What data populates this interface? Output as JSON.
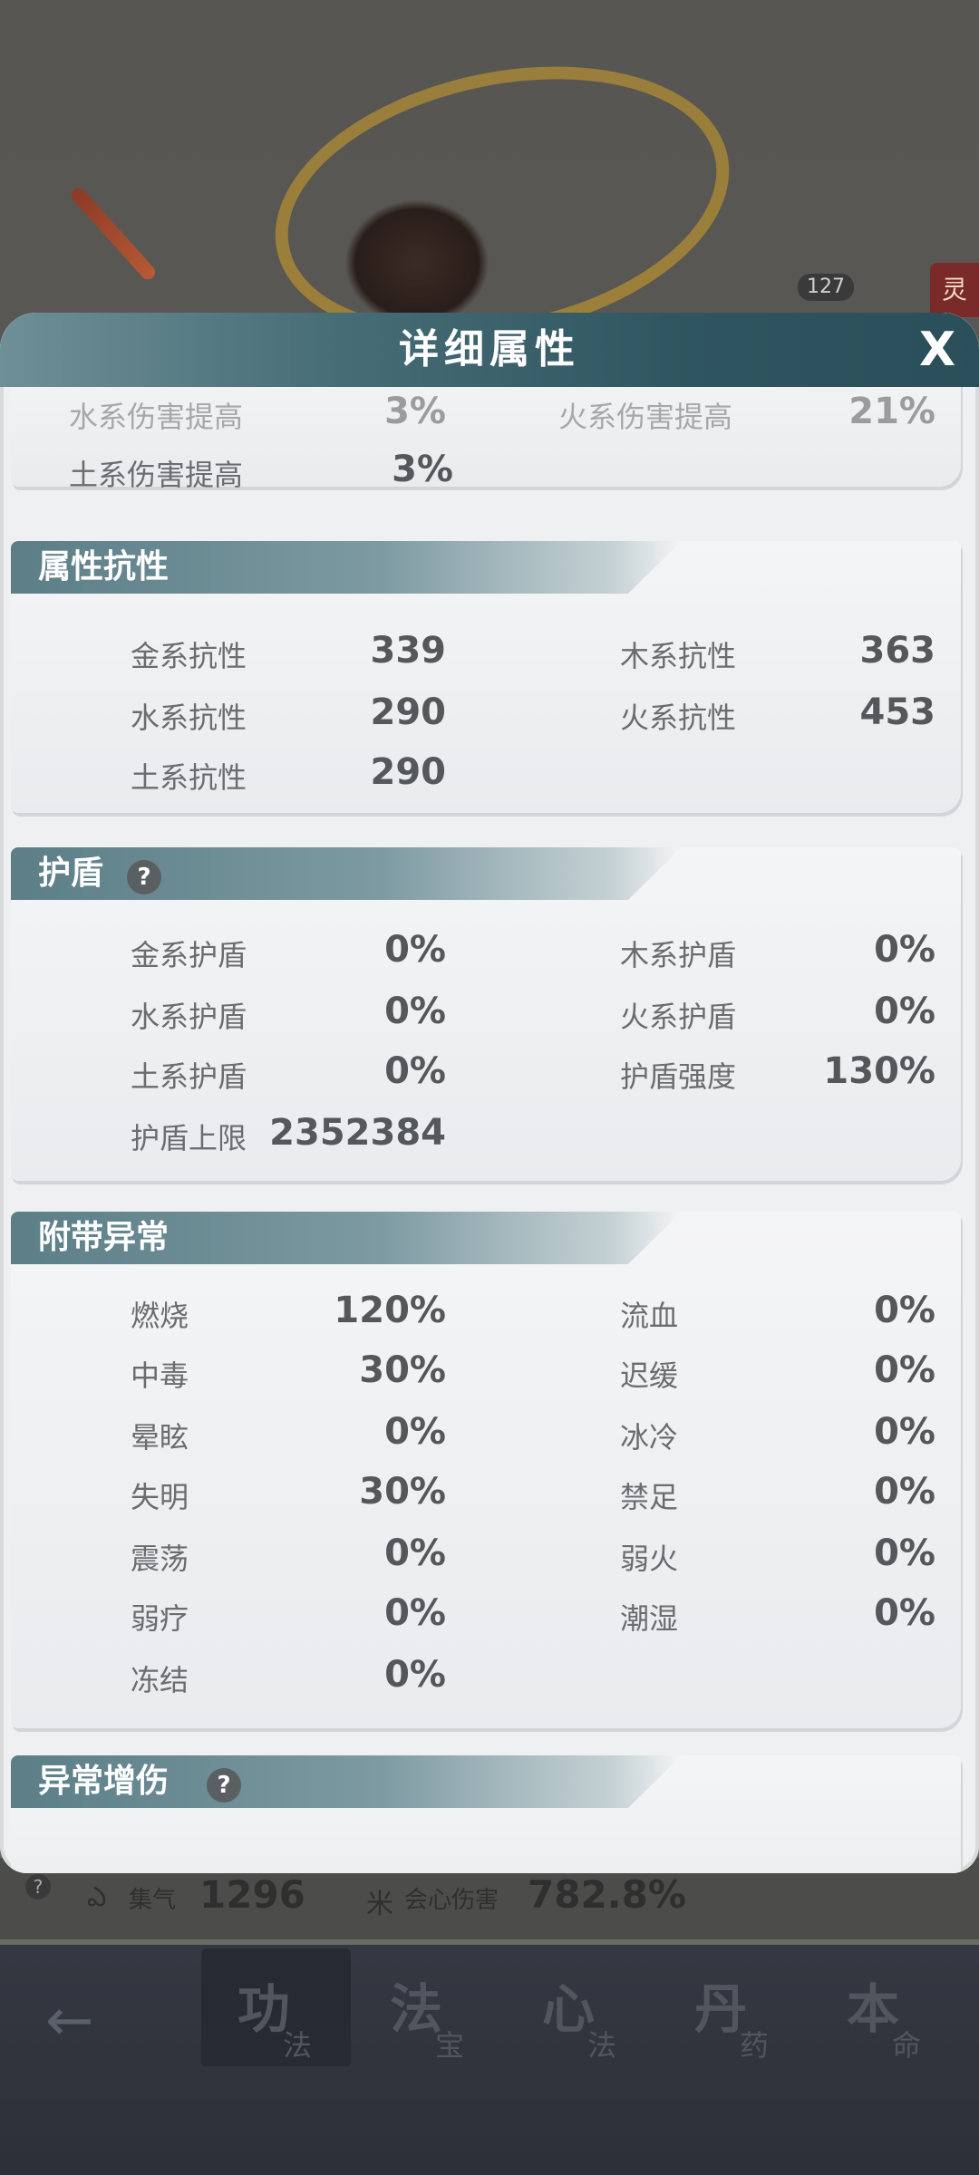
{
  "background": {
    "level_badge": "127",
    "side_tag": "灵",
    "stats": [
      {
        "icon": "swirl-icon",
        "glyph": "ఎ",
        "label": "集气",
        "value": "1296"
      },
      {
        "icon": "burst-icon",
        "glyph": "米",
        "label": "会心伤害",
        "value": "782.8%"
      }
    ]
  },
  "bottom_nav": {
    "back_icon": "back-arrow-icon",
    "tabs": [
      {
        "big": "功",
        "small": "法",
        "active": true
      },
      {
        "big": "法",
        "small": "宝",
        "active": false
      },
      {
        "big": "心",
        "small": "法",
        "active": false
      },
      {
        "big": "丹",
        "small": "药",
        "active": false
      },
      {
        "big": "本",
        "small": "命",
        "active": false
      }
    ]
  },
  "modal": {
    "title": "详细属性",
    "close_label": "X",
    "partial_top": {
      "rows": [
        {
          "left_label": "水系伤害提高",
          "left_value": "3%",
          "right_label": "火系伤害提高",
          "right_value": "21%"
        },
        {
          "left_label": "土系伤害提高",
          "left_value": "3%",
          "right_label": "",
          "right_value": ""
        }
      ]
    },
    "sections": [
      {
        "title": "属性抗性",
        "help": false,
        "rows": [
          {
            "left_label": "金系抗性",
            "left_value": "339",
            "right_label": "木系抗性",
            "right_value": "363"
          },
          {
            "left_label": "水系抗性",
            "left_value": "290",
            "right_label": "火系抗性",
            "right_value": "453"
          },
          {
            "left_label": "土系抗性",
            "left_value": "290",
            "right_label": "",
            "right_value": ""
          }
        ]
      },
      {
        "title": "护盾",
        "help": true,
        "rows": [
          {
            "left_label": "金系护盾",
            "left_value": "0%",
            "right_label": "木系护盾",
            "right_value": "0%"
          },
          {
            "left_label": "水系护盾",
            "left_value": "0%",
            "right_label": "火系护盾",
            "right_value": "0%"
          },
          {
            "left_label": "土系护盾",
            "left_value": "0%",
            "right_label": "护盾强度",
            "right_value": "130%"
          },
          {
            "left_label": "护盾上限",
            "left_value": "2352384",
            "right_label": "",
            "right_value": ""
          }
        ]
      },
      {
        "title": "附带异常",
        "help": false,
        "rows": [
          {
            "left_label": "燃烧",
            "left_value": "120%",
            "right_label": "流血",
            "right_value": "0%"
          },
          {
            "left_label": "中毒",
            "left_value": "30%",
            "right_label": "迟缓",
            "right_value": "0%"
          },
          {
            "left_label": "晕眩",
            "left_value": "0%",
            "right_label": "冰冷",
            "right_value": "0%"
          },
          {
            "left_label": "失明",
            "left_value": "30%",
            "right_label": "禁足",
            "right_value": "0%"
          },
          {
            "left_label": "震荡",
            "left_value": "0%",
            "right_label": "弱火",
            "right_value": "0%"
          },
          {
            "left_label": "弱疗",
            "left_value": "0%",
            "right_label": "潮湿",
            "right_value": "0%"
          },
          {
            "left_label": "冻结",
            "left_value": "0%",
            "right_label": "",
            "right_value": ""
          }
        ]
      },
      {
        "title": "异常增伤",
        "help": true,
        "rows": []
      }
    ]
  }
}
